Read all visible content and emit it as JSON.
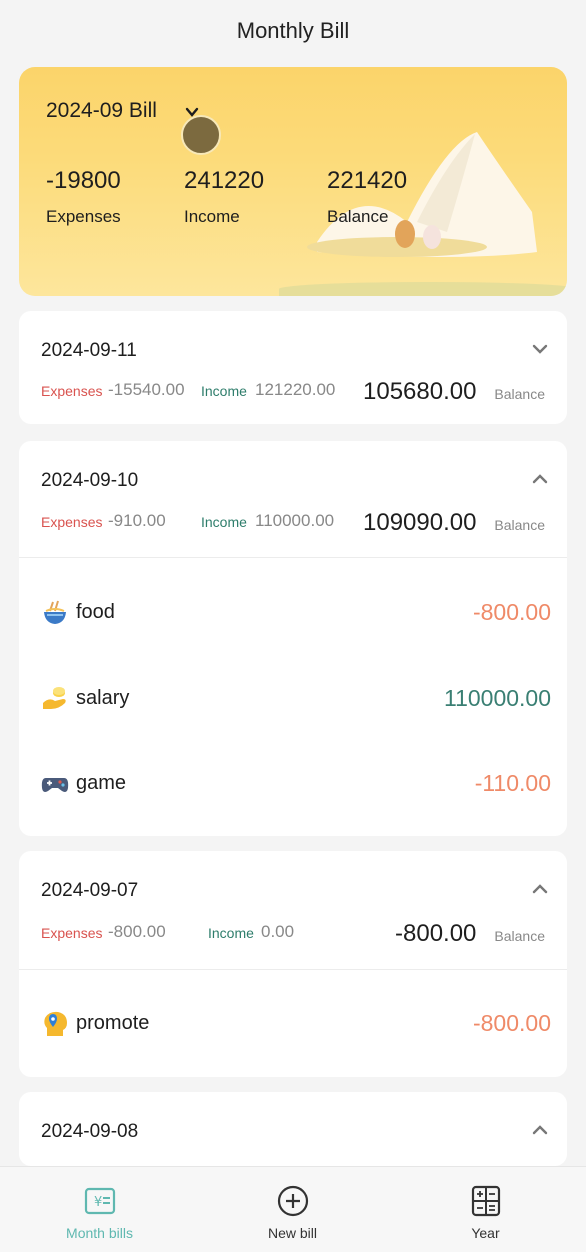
{
  "header": {
    "title": "Monthly Bill"
  },
  "summary": {
    "bill_title": "2024-09 Bill",
    "expenses_value": "-19800",
    "expenses_label": "Expenses",
    "income_value": "241220",
    "income_label": "Income",
    "balance_value": "221420",
    "balance_label": "Balance"
  },
  "days": [
    {
      "date": "2024-09-11",
      "expenses_label": "Expenses",
      "expenses": "-15540.00",
      "income_label": "Income",
      "income": "121220.00",
      "balance": "105680.00",
      "balance_label": "Balance",
      "expanded": false,
      "items": []
    },
    {
      "date": "2024-09-10",
      "expenses_label": "Expenses",
      "expenses": "-910.00",
      "income_label": "Income",
      "income": "110000.00",
      "balance": "109090.00",
      "balance_label": "Balance",
      "expanded": true,
      "items": [
        {
          "name": "food",
          "amount": "-800.00",
          "icon": "noodle-bowl-icon"
        },
        {
          "name": "salary",
          "amount": "110000.00",
          "icon": "money-hand-icon"
        },
        {
          "name": "game",
          "amount": "-110.00",
          "icon": "gamepad-icon"
        }
      ]
    },
    {
      "date": "2024-09-07",
      "expenses_label": "Expenses",
      "expenses": "-800.00",
      "income_label": "Income",
      "income": "0.00",
      "balance": "-800.00",
      "balance_label": "Balance",
      "expanded": true,
      "items": [
        {
          "name": "promote",
          "amount": "-800.00",
          "icon": "head-pin-icon"
        }
      ]
    },
    {
      "date": "2024-09-08",
      "expanded": true,
      "items": []
    }
  ],
  "tabbar": {
    "tabs": [
      {
        "label": "Month bills",
        "icon": "bill-icon",
        "active": true
      },
      {
        "label": "New bill",
        "icon": "plus-circle-icon",
        "active": false
      },
      {
        "label": "Year",
        "icon": "calculator-icon",
        "active": false
      }
    ]
  },
  "colors": {
    "expense_red": "#d9534f",
    "income_green": "#2e7d6b",
    "negative_amount": "#ef8a68",
    "positive_amount": "#3a7f73",
    "active_tab": "#5fb8b0",
    "summary_bg": "#fbd46a"
  }
}
